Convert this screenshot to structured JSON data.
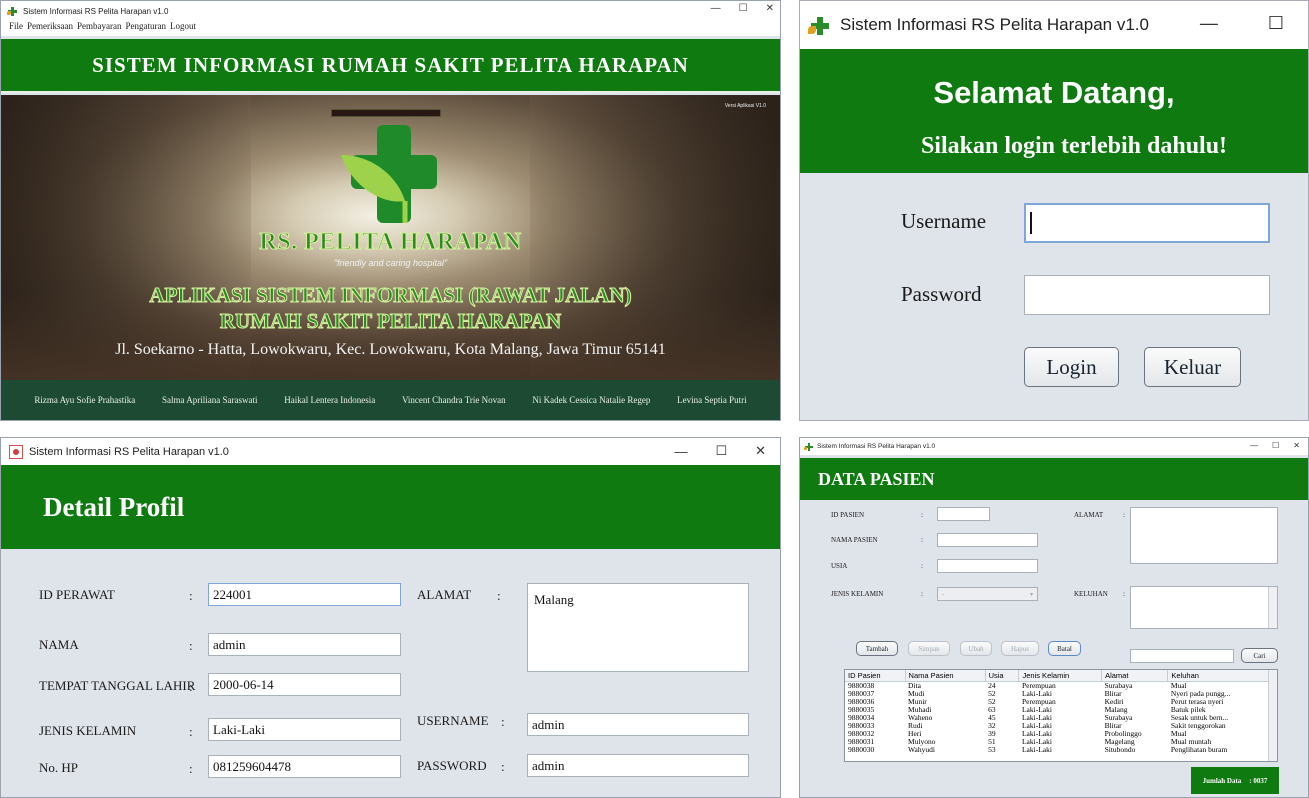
{
  "colors": {
    "brand_green": "#0f7a10",
    "footer_green": "#1d4a33",
    "window_bg": "#dfe3ea"
  },
  "main_window": {
    "title": "Sistem Informasi RS Pelita Harapan v1.0",
    "controls": {
      "minimize": "—",
      "maximize": "☐",
      "close": "✕"
    },
    "menu": [
      "File",
      "Pemeriksaan",
      "Pembayaran",
      "Pengaturan",
      "Logout"
    ],
    "banner": "SISTEM INFORMASI RUMAH SAKIT PELITA HARAPAN",
    "version_note": "Versi Aplikasi V1.0",
    "hospital_name": "RS. PELITA HARAPAN",
    "tagline": "\"friendly and caring hospital\"",
    "app_title_1": "APLIKASI SISTEM INFORMASI (RAWAT JALAN)",
    "app_title_2": "RUMAH SAKIT PELITA HARAPAN",
    "address": "Jl. Soekarno - Hatta, Lowokwaru, Kec. Lowokwaru, Kota Malang, Jawa Timur 65141",
    "credits": [
      "Rizma Ayu Sofie Prahastika",
      "Salma Apriliana Saraswati",
      "Haikal Lentera Indonesia",
      "Vincent Chandra Trie Novan",
      "Ni Kadek Cessica Natalie Regep",
      "Levina Septia Putri"
    ]
  },
  "login_window": {
    "title": "Sistem Informasi RS Pelita Harapan v1.0",
    "controls": {
      "minimize": "—",
      "maximize": "☐"
    },
    "welcome": "Selamat Datang,",
    "prompt": "Silakan login terlebih dahulu!",
    "username_label": "Username",
    "username_value": "",
    "password_label": "Password",
    "password_value": "",
    "login_button": "Login",
    "exit_button": "Keluar"
  },
  "profile_window": {
    "title": "Sistem Informasi RS Pelita Harapan v1.0",
    "controls": {
      "minimize": "—",
      "maximize": "☐",
      "close": "✕"
    },
    "heading": "Detail Profil",
    "fields": {
      "id_perawat": {
        "label": "ID PERAWAT",
        "value": "224001"
      },
      "nama": {
        "label": "NAMA",
        "value": "admin"
      },
      "ttl": {
        "label": "TEMPAT TANGGAL LAHIR",
        "value": "2000-06-14"
      },
      "jenis_kelamin": {
        "label": "JENIS KELAMIN",
        "value": "Laki-Laki"
      },
      "no_hp": {
        "label": "No. HP",
        "value": "081259604478"
      },
      "alamat": {
        "label": "ALAMAT",
        "value": "Malang"
      },
      "username": {
        "label": "USERNAME",
        "value": "admin"
      },
      "password": {
        "label": "PASSWORD",
        "value": "admin"
      }
    },
    "colon": ":"
  },
  "patient_window": {
    "title": "Sistem Informasi RS Pelita Harapan v1.0",
    "controls": {
      "minimize": "—",
      "maximize": "☐",
      "close": "✕"
    },
    "heading": "DATA PASIEN",
    "labels": {
      "id_pasien": "ID PASIEN",
      "nama_pasien": "NAMA PASIEN",
      "usia": "USIA",
      "jenis_kelamin": "JENIS KELAMIN",
      "alamat": "ALAMAT",
      "keluhan": "KELUHAN"
    },
    "colon": ":",
    "gender_select": "-",
    "buttons": {
      "tambah": "Tambah",
      "simpan": "Simpan",
      "ubah": "Ubah",
      "hapus": "Hapus",
      "batal": "Batal",
      "cari": "Cari"
    },
    "search_value": "",
    "table": {
      "columns": [
        "ID Pasien",
        "Nama Pasien",
        "Usia",
        "Jenis Kelamin",
        "Alamat",
        "Keluhan"
      ],
      "rows": [
        [
          "9880038",
          "Dita",
          "24",
          "Perempuan",
          "Surabaya",
          "Mual"
        ],
        [
          "9880037",
          "Mudi",
          "52",
          "Laki-Laki",
          "Blitar",
          "Nyeri pada pungg..."
        ],
        [
          "9880036",
          "Munir",
          "52",
          "Perempuan",
          "Kediri",
          "Perut terasa nyeri"
        ],
        [
          "9880035",
          "Muhadi",
          "63",
          "Laki-Laki",
          "Malang",
          "Batuk pilek"
        ],
        [
          "9880034",
          "Waheno",
          "45",
          "Laki-Laki",
          "Surabaya",
          "Sesak untuk bern..."
        ],
        [
          "9880033",
          "Rudi",
          "32",
          "Laki-Laki",
          "Blitar",
          "Sakit tenggorokan"
        ],
        [
          "9880032",
          "Heri",
          "39",
          "Laki-Laki",
          "Probolinggo",
          "Mual"
        ],
        [
          "9880031",
          "Mulyono",
          "51",
          "Laki-Laki",
          "Magelang",
          "Mual muntah"
        ],
        [
          "9880030",
          "Wahyudi",
          "53",
          "Laki-Laki",
          "Situbondo",
          "Penglihatan buram"
        ]
      ]
    },
    "count_label": "Jumlah Data",
    "count_value": ": 0037"
  }
}
